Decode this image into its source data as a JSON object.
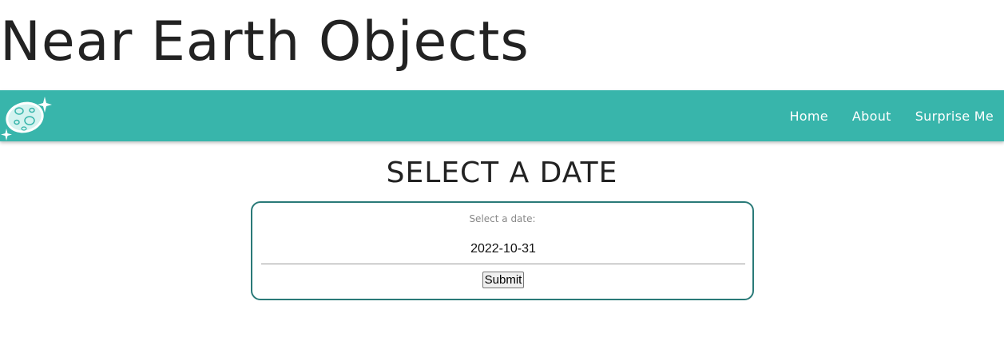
{
  "site": {
    "title": "Near Earth Objects"
  },
  "navbar": {
    "logo_icon": "asteroid-with-sparkles-icon",
    "background_color": "#38b5ab",
    "links": [
      {
        "label": "Home"
      },
      {
        "label": "About"
      },
      {
        "label": "Surprise Me"
      }
    ]
  },
  "main": {
    "heading": "SELECT A DATE",
    "form": {
      "label": "Select a date:",
      "date_value": "2022-10-31",
      "submit_label": "Submit",
      "border_color": "#2a7a78"
    }
  }
}
